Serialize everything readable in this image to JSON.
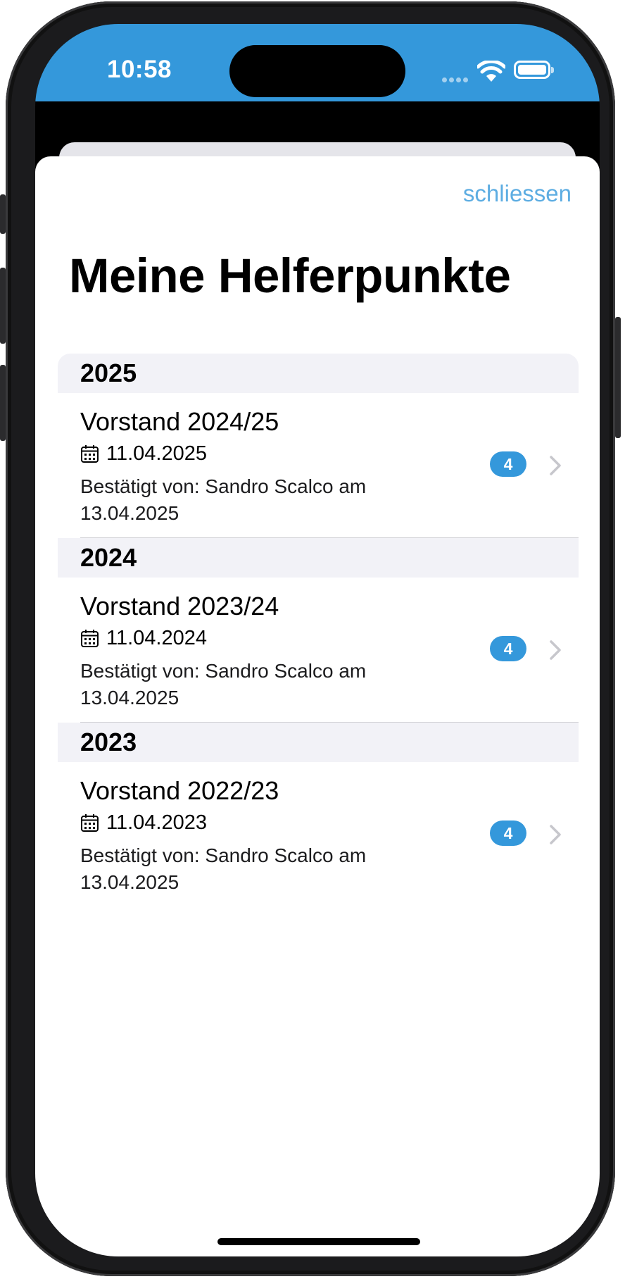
{
  "status_bar": {
    "time": "10:58"
  },
  "modal": {
    "close_label": "schliessen",
    "title": "Meine Helferpunkte"
  },
  "sections": [
    {
      "year": "2025",
      "entries": [
        {
          "title": "Vorstand 2024/25",
          "date": "11.04.2025",
          "confirmed_by": "Bestätigt von: Sandro Scalco am 13.04.2025",
          "points": "4"
        }
      ]
    },
    {
      "year": "2024",
      "entries": [
        {
          "title": "Vorstand 2023/24",
          "date": "11.04.2024",
          "confirmed_by": "Bestätigt von: Sandro Scalco am 13.04.2025",
          "points": "4"
        }
      ]
    },
    {
      "year": "2023",
      "entries": [
        {
          "title": "Vorstand 2022/23",
          "date": "11.04.2023",
          "confirmed_by": "Bestätigt von: Sandro Scalco am 13.04.2025",
          "points": "4"
        }
      ]
    }
  ],
  "icons": {
    "date": "calendar-icon",
    "disclosure": "chevron-right-icon"
  },
  "colors": {
    "accent": "#3498db",
    "link": "#5dade2",
    "section_bg": "#f2f2f7"
  }
}
